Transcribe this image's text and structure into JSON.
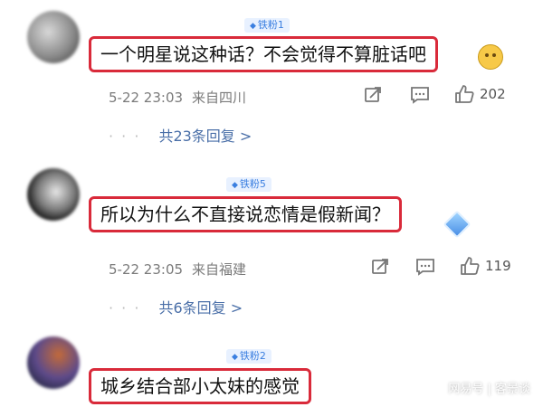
{
  "comments": [
    {
      "badge": "铁粉1",
      "text": "一个明星说这种话？不会觉得不算脏话吧",
      "time": "5-22 23:03",
      "location": "来自四川",
      "likes": "202",
      "replies": "共23条回复 >",
      "emoji_icon": "smiley-face-emoji"
    },
    {
      "badge": "铁粉5",
      "text": "所以为什么不直接说恋情是假新闻？",
      "time": "5-22 23:05",
      "location": "来自福建",
      "likes": "119",
      "replies": "共6条回复 >",
      "emoji_icon": "diamond-emoji"
    },
    {
      "badge": "铁粉2",
      "text": "城乡结合部小太妹的感觉"
    }
  ],
  "icons": {
    "share": "share-icon",
    "comment": "comment-icon",
    "like": "thumbs-up-icon",
    "badge": "diamond-badge-icon"
  },
  "colors": {
    "highlight_border": "#d92a3a",
    "badge_text": "#3b7fe0",
    "reply_link": "#4a6fa8"
  },
  "watermark": "网易号 | 客景谈"
}
